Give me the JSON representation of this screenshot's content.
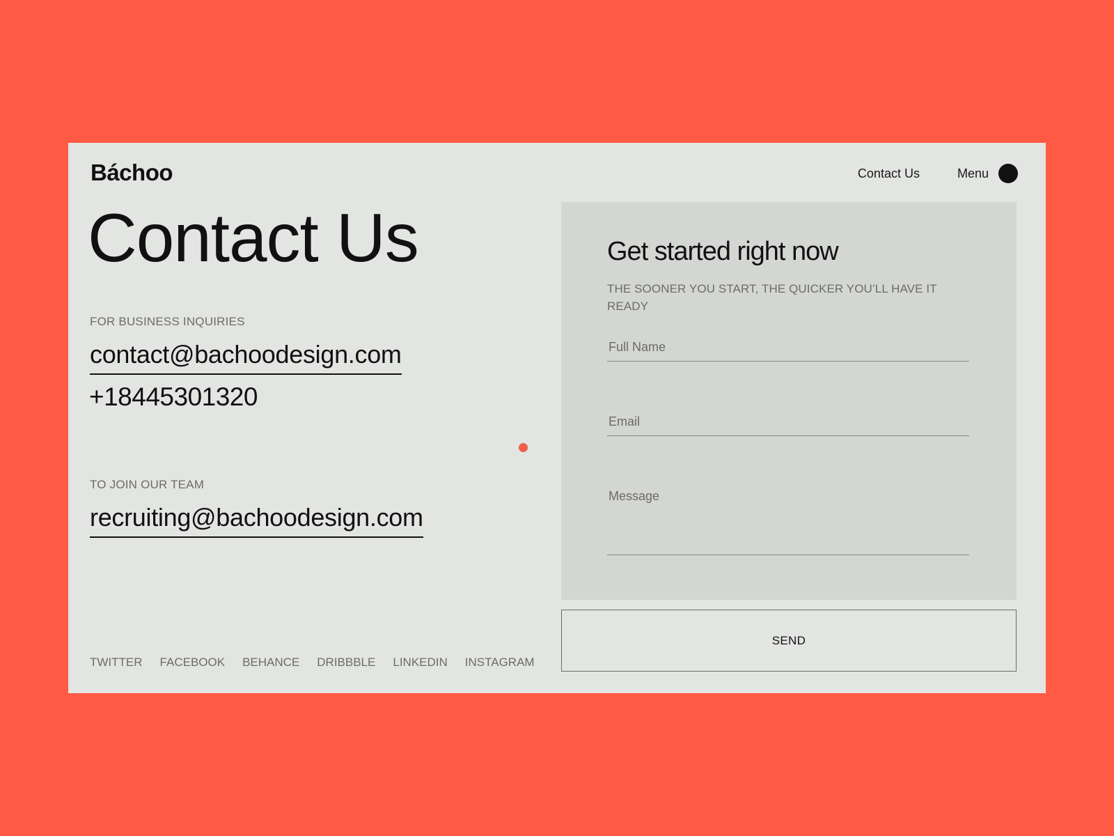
{
  "colors": {
    "background": "#ff5a43",
    "page": "#e3e5e2",
    "form_panel": "#d4d6d3",
    "accent_dot": "#ef5f4a",
    "text_primary": "#111111",
    "text_muted": "#6b6c6a"
  },
  "header": {
    "logo": "Báchoo",
    "nav": {
      "contact_label": "Contact Us",
      "menu_label": "Menu",
      "menu_icon": "circle-menu-icon"
    }
  },
  "hero": {
    "title": "Contact Us"
  },
  "business": {
    "label": "FOR BUSINESS INQUIRIES",
    "email": "contact@bachoodesign.com",
    "phone": "+18445301320"
  },
  "careers": {
    "label": "TO JOIN OUR TEAM",
    "email": "recruiting@bachoodesign.com"
  },
  "socials": [
    {
      "label": "TWITTER"
    },
    {
      "label": "FACEBOOK"
    },
    {
      "label": "BEHANCE"
    },
    {
      "label": "DRIBBBLE"
    },
    {
      "label": "LINKEDIN"
    },
    {
      "label": "INSTAGRAM"
    }
  ],
  "form": {
    "title": "Get started right now",
    "subtitle": "THE SOONER YOU START, THE QUICKER YOU’LL HAVE IT READY",
    "fields": {
      "full_name": {
        "placeholder": "Full Name",
        "value": ""
      },
      "email": {
        "placeholder": "Email",
        "value": ""
      },
      "message": {
        "placeholder": "Message",
        "value": ""
      }
    },
    "submit_label": "SEND"
  }
}
